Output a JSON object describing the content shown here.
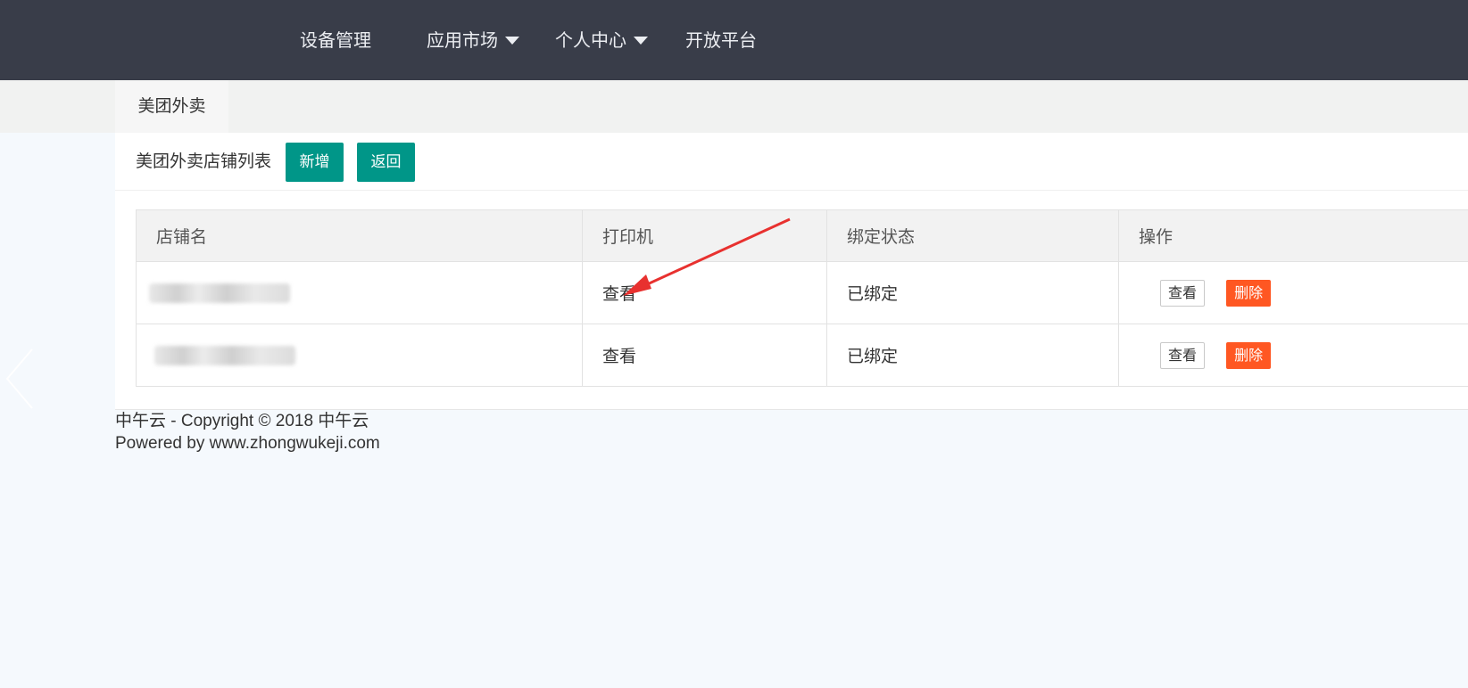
{
  "nav": {
    "items": [
      {
        "label": "设备管理",
        "dropdown": false
      },
      {
        "label": "应用市场",
        "dropdown": true
      },
      {
        "label": "个人中心",
        "dropdown": true
      },
      {
        "label": "开放平台",
        "dropdown": false
      }
    ]
  },
  "tabs": [
    {
      "label": "美团外卖"
    }
  ],
  "panel": {
    "title": "美团外卖店铺列表",
    "add_label": "新增",
    "back_label": "返回"
  },
  "table": {
    "headers": [
      "店铺名",
      "打印机",
      "绑定状态",
      "操作"
    ],
    "rows": [
      {
        "printer": "查看",
        "status": "已绑定",
        "view_label": "查看",
        "delete_label": "删除"
      },
      {
        "printer": "查看",
        "status": "已绑定",
        "view_label": "查看",
        "delete_label": "删除"
      }
    ]
  },
  "footer": {
    "copyright": "中午云 - Copyright © 2018 中午云",
    "powered": "Powered by www.zhongwukeji.com"
  },
  "colors": {
    "topbar": "#393d49",
    "primary": "#009688",
    "danger": "#ff5722",
    "annotation": "#e8312f"
  },
  "icons": {
    "left_arrow": "chevron-left-icon",
    "caret": "caret-down-icon"
  }
}
